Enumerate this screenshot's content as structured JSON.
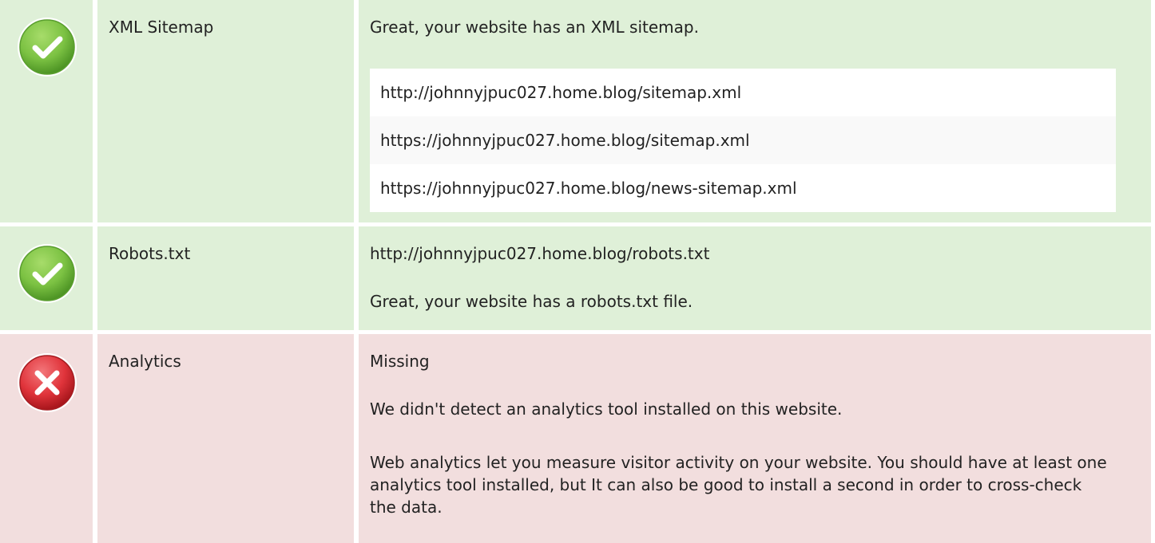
{
  "checks": {
    "sitemap": {
      "status": "pass",
      "name": "XML Sitemap",
      "message": "Great, your website has an XML sitemap.",
      "urls": [
        "http://johnnyjpuc027.home.blog/sitemap.xml",
        "https://johnnyjpuc027.home.blog/sitemap.xml",
        "https://johnnyjpuc027.home.blog/news-sitemap.xml"
      ]
    },
    "robots": {
      "status": "pass",
      "name": "Robots.txt",
      "url": "http://johnnyjpuc027.home.blog/robots.txt",
      "message": "Great, your website has a robots.txt file."
    },
    "analytics": {
      "status": "fail",
      "name": "Analytics",
      "value": "Missing",
      "message": "We didn't detect an analytics tool installed on this website.",
      "advice": "Web analytics let you measure visitor activity on your website. You should have at least one analytics tool installed, but It can also be good to install a second in order to cross-check the data."
    }
  },
  "colors": {
    "pass_bg": "#dff0d8",
    "fail_bg": "#f2dede",
    "pass_icon": "#7cc243",
    "fail_icon": "#e0343b"
  },
  "icons": {
    "pass": "check-circle-icon",
    "fail": "cross-circle-icon"
  }
}
